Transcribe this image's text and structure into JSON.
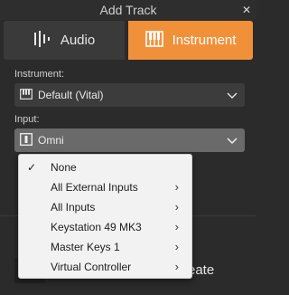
{
  "window": {
    "title": "Add Track",
    "close_glyph": "✕"
  },
  "type_toggle": {
    "audio_label": "Audio",
    "instrument_label": "Instrument",
    "selected": "Instrument",
    "accent": "#f0913a"
  },
  "instrument": {
    "label": "Instrument:",
    "value": "Default (Vital)",
    "icon": "piano-keys-icon"
  },
  "input": {
    "label": "Input:",
    "value": "Omni",
    "icon": "input-port-icon"
  },
  "input_menu": {
    "items": [
      {
        "label": "None",
        "checked": true,
        "submenu": false
      },
      {
        "label": "All External Inputs",
        "checked": false,
        "submenu": true
      },
      {
        "label": "All Inputs",
        "checked": false,
        "submenu": true
      },
      {
        "label": "Keystation 49 MK3",
        "checked": false,
        "submenu": true
      },
      {
        "label": "Master Keys 1",
        "checked": false,
        "submenu": true
      },
      {
        "label": "Virtual Controller",
        "checked": false,
        "submenu": true
      }
    ],
    "check_glyph": "✓",
    "submenu_glyph": "›"
  },
  "footer": {
    "create_label": "reate"
  }
}
